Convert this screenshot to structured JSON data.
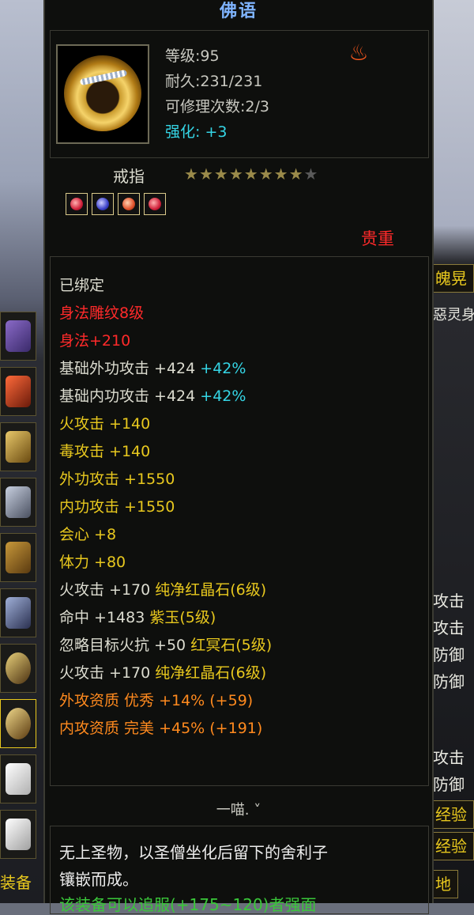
{
  "tooltip": {
    "title": "佛语",
    "level": "等级:95",
    "durability": "耐久:231/231",
    "repairs": "可修理次数:2/3",
    "strengthen_label": "强化:",
    "strengthen_value": "+3",
    "item_type": "戒指",
    "stars_filled": 8,
    "stars_total": 9,
    "gems": [
      "red",
      "purple",
      "orange",
      "red"
    ],
    "quality": "贵重"
  },
  "attributes": [
    {
      "text": "已绑定",
      "color": "white"
    },
    {
      "text": "身法雕纹8级",
      "color": "red"
    },
    {
      "text": "身法+210",
      "color": "red"
    },
    {
      "text": "基础外功攻击 +424",
      "extra": "+42%",
      "color": "white"
    },
    {
      "text": "基础内功攻击 +424",
      "extra": "+42%",
      "color": "white"
    },
    {
      "text": "火攻击 +140",
      "color": "yellow"
    },
    {
      "text": "毒攻击 +140",
      "color": "yellow"
    },
    {
      "text": "外功攻击 +1550",
      "color": "yellow"
    },
    {
      "text": "内功攻击 +1550",
      "color": "yellow"
    },
    {
      "text": "会心 +8",
      "color": "yellow"
    },
    {
      "text": "体力 +80",
      "color": "yellow"
    },
    {
      "text": "火攻击 +170 纯净红晶石(6级)",
      "color": "white",
      "gem_part": "纯净红晶石(6级)"
    },
    {
      "text": "命中 +1483 紫玉(5级)",
      "color": "white",
      "gem_part": "紫玉(5级)"
    },
    {
      "text": "忽略目标火抗 +50 红冥石(5级)",
      "color": "white",
      "gem_part": "红冥石(5级)"
    },
    {
      "text": "火攻击 +170 纯净红晶石(6级)",
      "color": "white",
      "gem_part": "纯净红晶石(6级)"
    },
    {
      "text": "外攻资质  优秀 +14% (+59)",
      "color": "orange"
    },
    {
      "text": "内攻资质  完美 +45% (+191)",
      "color": "orange"
    }
  ],
  "owner": "一喵.",
  "owner_chevron": "˅",
  "description": {
    "line1": "无上圣物，以圣僧坐化后留下的舍利子",
    "line2": "镶嵌而成。",
    "line3": "该装备可以追服(+175~120)者强面"
  },
  "left_panel": {
    "icons": [
      "necklace",
      "bracer",
      "bracer-gold",
      "armor",
      "belt",
      "boots",
      "ring",
      "ring-selected",
      "mask",
      "mask"
    ],
    "equip_label": "装备"
  },
  "right_panel": {
    "title_fragment": "魄晃",
    "subtitle_fragment": "惡灵身",
    "labels": [
      "攻击",
      "攻击",
      "防御",
      "防御",
      "攻击",
      "防御"
    ],
    "tabs": [
      "经验",
      "经验"
    ],
    "bottom_tab": "地"
  },
  "colors": {
    "red": "#ff2a2a",
    "yellow": "#e8c81e",
    "cyan": "#35d6e6",
    "orange": "#ff8a1e",
    "white": "#dcdcd0",
    "title": "#7fb4ff"
  }
}
